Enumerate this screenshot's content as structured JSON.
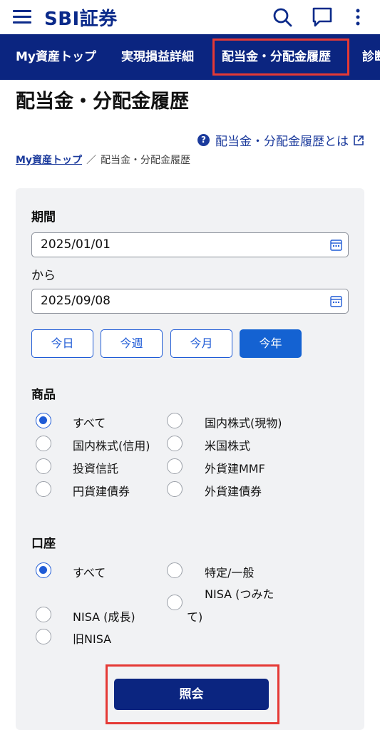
{
  "header": {
    "logo": "SBI証券",
    "icons": [
      "menu-icon",
      "search-icon",
      "chat-icon",
      "more-vert-icon"
    ]
  },
  "nav": {
    "items": [
      "My資産トップ",
      "実現損益詳細",
      "配当金・分配金履歴",
      "診断"
    ]
  },
  "page": {
    "title": "配当金・分配金履歴",
    "help_link": "配当金・分配金履歴とは",
    "breadcrumb": {
      "home": "My資産トップ",
      "separator": "／",
      "current": "配当金・分配金履歴"
    }
  },
  "form": {
    "period_label": "期間",
    "from_date": "2025/01/01",
    "from_label": "から",
    "to_date": "2025/09/08",
    "quick_buttons": [
      "今日",
      "今週",
      "今月",
      "今年"
    ],
    "active_quick": "今年",
    "product_label": "商品",
    "products": [
      "すべて",
      "国内株式(現物)",
      "国内株式(信用)",
      "米国株式",
      "投資信託",
      "外貨建MMF",
      "円貨建債券",
      "外貨建債券"
    ],
    "selected_product": "すべて",
    "account_label": "口座",
    "accounts": [
      "すべて",
      "特定/一般",
      "NISA (成長)",
      "NISA (つみた",
      "て)",
      "旧NISA"
    ],
    "selected_account": "すべて",
    "submit_label": "照会"
  },
  "colors": {
    "brand": "#0b2a8a",
    "nav_bg": "#0b2580",
    "accent": "#1f5bd6",
    "highlight": "#e53935"
  }
}
